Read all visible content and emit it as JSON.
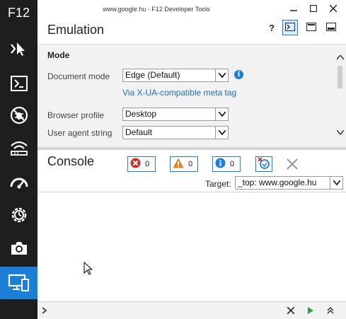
{
  "sidebar": {
    "title": "F12",
    "items": [
      {
        "name": "dom-explorer",
        "icon": "pointer-icon"
      },
      {
        "name": "console",
        "icon": "console-icon"
      },
      {
        "name": "debugger",
        "icon": "bug-icon"
      },
      {
        "name": "network",
        "icon": "wifi-icon"
      },
      {
        "name": "performance",
        "icon": "gauge-icon"
      },
      {
        "name": "memory",
        "icon": "clock-gear-icon"
      },
      {
        "name": "screenshot",
        "icon": "camera-icon"
      },
      {
        "name": "emulation",
        "icon": "devices-icon",
        "active": true
      }
    ],
    "colors": {
      "background": "#1e1e1e",
      "active": "#1b7fd6"
    }
  },
  "window": {
    "title": "www.google.hu - F12 Developer Tools",
    "controls": [
      "minimize-icon",
      "maximize-icon",
      "close-icon"
    ]
  },
  "emulation": {
    "title": "Emulation",
    "header_buttons": [
      {
        "name": "help",
        "label": "?"
      },
      {
        "name": "console-toggle",
        "icon": "console-icon",
        "active": true
      },
      {
        "name": "dock",
        "icon": "dock-icon"
      },
      {
        "name": "undock",
        "icon": "undock-icon"
      }
    ],
    "section": "Mode",
    "document_mode": {
      "label": "Document mode",
      "value": "Edge (Default)",
      "link": "Via X-UA-compatible meta tag"
    },
    "browser_profile": {
      "label": "Browser profile",
      "value": "Desktop"
    },
    "user_agent": {
      "label": "User agent string",
      "value": "Default"
    }
  },
  "console": {
    "title": "Console",
    "errors": "0",
    "warnings": "0",
    "messages": "0",
    "target_label": "Target:",
    "target_value": "_top: www.google.hu"
  },
  "accent": "#1b7fd6"
}
